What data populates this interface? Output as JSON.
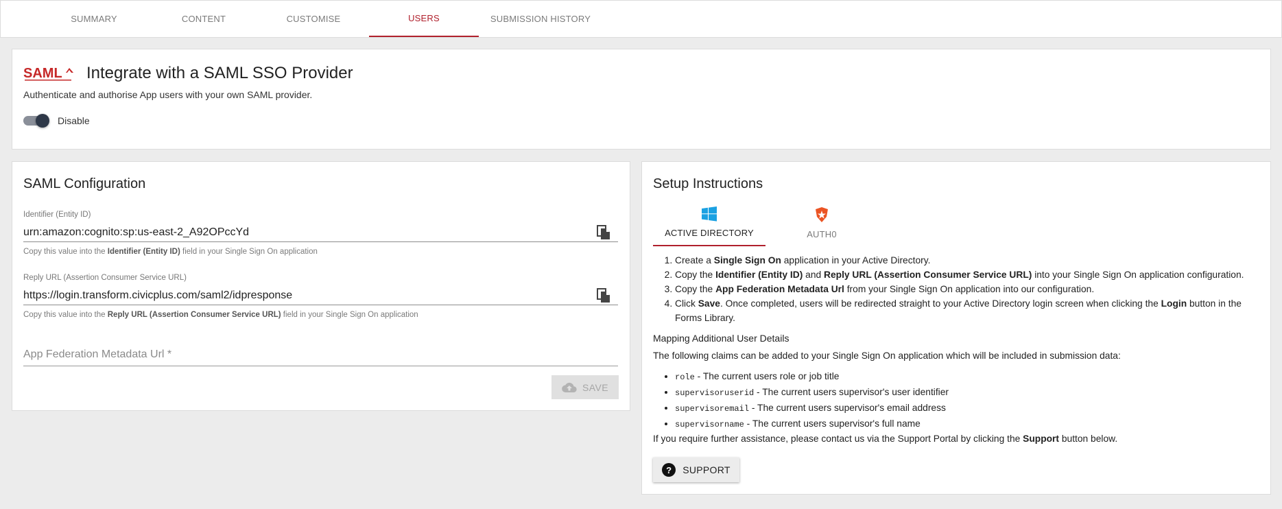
{
  "tabs": [
    {
      "label": "SUMMARY",
      "active": false
    },
    {
      "label": "CONTENT",
      "active": false
    },
    {
      "label": "CUSTOMISE",
      "active": false
    },
    {
      "label": "USERS",
      "active": true
    },
    {
      "label": "SUBMISSION HISTORY",
      "active": false
    }
  ],
  "integration": {
    "logo": "SAML",
    "logo_icon": "saml-logo",
    "title": "Integrate with a SAML SSO Provider",
    "subtitle": "Authenticate and authorise App users with your own SAML provider.",
    "toggle_label": "Disable",
    "toggle_on": true
  },
  "config": {
    "title": "SAML Configuration",
    "identifier": {
      "label": "Identifier (Entity ID)",
      "value": "urn:amazon:cognito:sp:us-east-2_A92OPccYd",
      "help_pre": "Copy this value into the ",
      "help_bold": "Identifier (Entity ID)",
      "help_post": " field in your Single Sign On application"
    },
    "reply_url": {
      "label": "Reply URL (Assertion Consumer Service URL)",
      "value": "https://login.transform.civicplus.com/saml2/idpresponse",
      "help_pre": "Copy this value into the ",
      "help_bold": "Reply URL (Assertion Consumer Service URL)",
      "help_post": " field in your Single Sign On application"
    },
    "metadata_placeholder": "App Federation Metadata Url *",
    "save_label": "SAVE"
  },
  "setup": {
    "title": "Setup Instructions",
    "tabs": [
      {
        "label": "ACTIVE DIRECTORY",
        "icon": "windows-icon",
        "active": true
      },
      {
        "label": "AUTH0",
        "icon": "auth0-icon",
        "active": false
      }
    ],
    "steps": [
      {
        "parts": [
          {
            "t": "Create a "
          },
          {
            "b": "Single Sign On"
          },
          {
            "t": " application in your Active Directory."
          }
        ]
      },
      {
        "parts": [
          {
            "t": "Copy the "
          },
          {
            "b": "Identifier (Entity ID)"
          },
          {
            "t": " and "
          },
          {
            "b": "Reply URL (Assertion Consumer Service URL)"
          },
          {
            "t": " into your Single Sign On application configuration."
          }
        ]
      },
      {
        "parts": [
          {
            "t": "Copy the "
          },
          {
            "b": "App Federation Metadata Url"
          },
          {
            "t": " from your Single Sign On application into our configuration."
          }
        ]
      },
      {
        "parts": [
          {
            "t": "Click "
          },
          {
            "b": "Save"
          },
          {
            "t": ". Once completed, users will be redirected straight to your Active Directory login screen when clicking the "
          },
          {
            "b": "Login"
          },
          {
            "t": " button in the Forms Library."
          }
        ]
      }
    ],
    "mapping_heading": "Mapping Additional User Details",
    "claims_intro": "The following claims can be added to your Single Sign On application which will be included in submission data:",
    "claims": [
      {
        "code": "role",
        "desc": " - The current users role or job title"
      },
      {
        "code": "supervisoruserid",
        "desc": " - The current users supervisor's user identifier"
      },
      {
        "code": "supervisoremail",
        "desc": " - The current users supervisor's email address"
      },
      {
        "code": "supervisorname",
        "desc": " - The current users supervisor's full name"
      }
    ],
    "assist_pre": "If you require further assistance, please contact us via the Support Portal by clicking the ",
    "assist_bold": "Support",
    "assist_post": " button below.",
    "support_label": "SUPPORT"
  },
  "colors": {
    "accent": "#b0202c",
    "windows": "#1ba1e2",
    "auth0": "#eb5424"
  }
}
